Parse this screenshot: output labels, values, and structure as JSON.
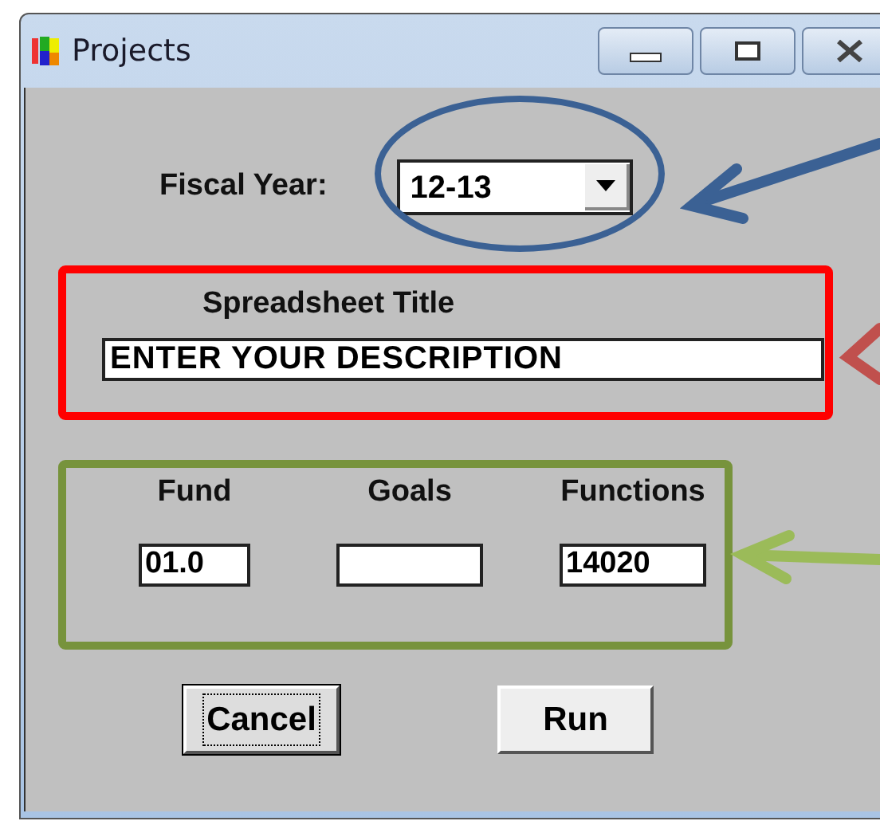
{
  "window": {
    "title": "Projects"
  },
  "fiscal_year": {
    "label": "Fiscal Year:",
    "value": "12-13"
  },
  "spreadsheet_title": {
    "label": "Spreadsheet Title",
    "value": "ENTER YOUR DESCRIPTION"
  },
  "codes": [
    {
      "label": "Fund",
      "value": "01.0"
    },
    {
      "label": "Goals"
    },
    {
      "label": "Functions",
      "value": "14020"
    }
  ],
  "buttons": [
    {
      "label": "Cancel",
      "focused": true
    },
    {
      "label": "Run",
      "focused": false
    }
  ]
}
